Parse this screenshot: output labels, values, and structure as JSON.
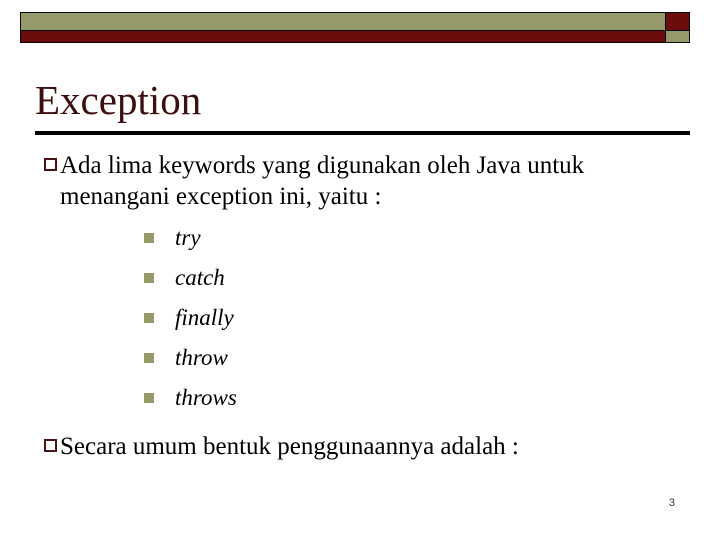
{
  "slide": {
    "title": "Exception",
    "page_number": "3",
    "colors": {
      "olive": "#969a6b",
      "maroon": "#6b0d0d",
      "title_text": "#3d1010",
      "body_text": "#000000",
      "rule": "#000000"
    },
    "header": {
      "top_bar_color": "#969a6b",
      "top_cap_color": "#6b0d0d",
      "bottom_bar_color": "#6b0d0d",
      "bottom_cap_color": "#969a6b"
    },
    "bullets": [
      {
        "marker": "hollow-square",
        "text": "Ada lima keywords yang digunakan oleh Java untuk menangani exception ini, yaitu :",
        "sub_bullets": [
          {
            "marker": "filled-square",
            "text": "try"
          },
          {
            "marker": "filled-square",
            "text": "catch"
          },
          {
            "marker": "filled-square",
            "text": "finally"
          },
          {
            "marker": "filled-square",
            "text": "throw"
          },
          {
            "marker": "filled-square",
            "text": "throws"
          }
        ]
      },
      {
        "marker": "hollow-square",
        "text": "Secara umum bentuk penggunaannya adalah :",
        "sub_bullets": []
      }
    ]
  }
}
